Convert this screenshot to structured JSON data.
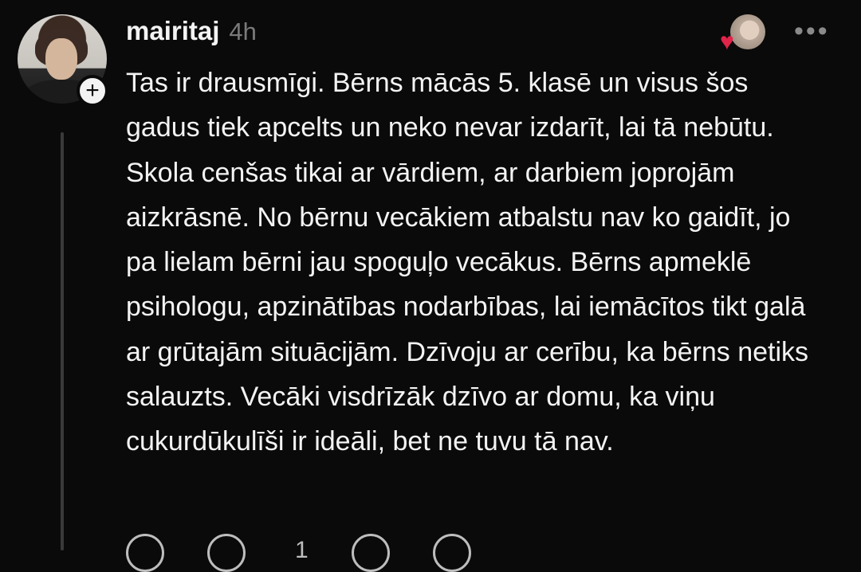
{
  "post": {
    "username": "mairitaj",
    "time": "4h",
    "text": "Tas ir drausmīgi. Bērns mācās 5. klasē un visus šos gadus tiek apcelts un neko nevar izdarīt, lai tā nebūtu. Skola cenšas tikai ar vārdiem, ar darbiem joprojām aizkrāsnē. No bērnu vecākiem atbalstu nav ko gaidīt, jo pa lielam bērni jau spoguļo vecākus. Bērns apmeklē psihologu, apzinātības nodarbības, lai iemācītos tikt galā ar grūtajām situācijām. Dzīvoju ar cerību, ka bērns netiks salauzts. Vecāki visdrīzāk dzīvo ar domu, ka viņu cukurdūkulīši ir ideāli, bet ne tuvu tā nav.",
    "more_label": "•••",
    "follow_label": "+",
    "reply_count": "1"
  },
  "colors": {
    "background": "#0a0a0a",
    "text": "#f3f3f3",
    "muted": "#7a7a7a",
    "heart": "#e0244a"
  },
  "icons": [
    "plus-icon",
    "heart-icon",
    "more-icon",
    "like-icon",
    "comment-icon",
    "repost-icon",
    "share-icon"
  ]
}
